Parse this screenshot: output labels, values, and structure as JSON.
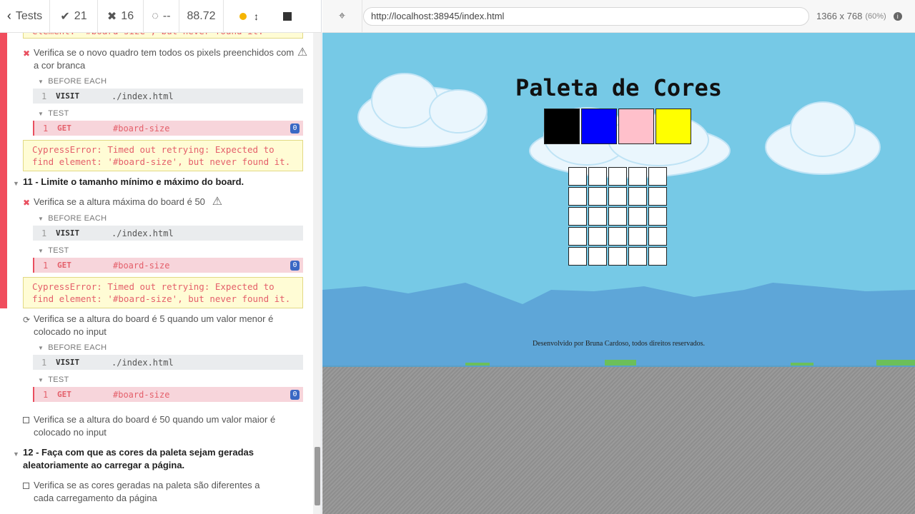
{
  "reporter": {
    "header": {
      "tests_label": "Tests",
      "passed": "21",
      "failed": "16",
      "pending": "--",
      "duration": "88.72"
    },
    "items": {
      "test_a_label": "Verifica se o novo quadro tem todos os pixels preenchidos com a cor branca",
      "err_top": "element: '#board-size', but never found it.",
      "before_each": "BEFORE EACH",
      "test_hook": "TEST",
      "visit_num": "1",
      "visit_name": "VISIT",
      "visit_msg": "./index.html",
      "get_num": "1",
      "get_name": "GET",
      "get_msg": "#board-size",
      "get_badge": "0",
      "error_msg": "CypressError: Timed out retrying: Expected to find element: '#board-size', but never found it.",
      "suite_11": "11 - Limite o tamanho mínimo e máximo do board.",
      "test_b_label": "Verifica se a altura máxima do board é 50",
      "test_c_label": "Verifica se a altura do board é 5 quando um valor menor é colocado no input",
      "test_d_label": "Verifica se a altura do board é 50 quando um valor maior é colocado no input",
      "suite_12": "12 - Faça com que as cores da paleta sejam geradas aleatoriamente ao carregar a página.",
      "test_e_label": "Verifica se as cores geradas na paleta são diferentes a cada carregamento da página"
    }
  },
  "aut": {
    "url": "http://localhost:38945/index.html",
    "viewport": "1366 x 768",
    "scale": "(60%)",
    "page": {
      "title": "Paleta de Cores",
      "palette_colors": [
        "#000000",
        "#0000ff",
        "#ffc0cb",
        "#ffff00"
      ],
      "footer": "Desenvolvido por Bruna Cardoso, todos direitos reservados."
    }
  }
}
